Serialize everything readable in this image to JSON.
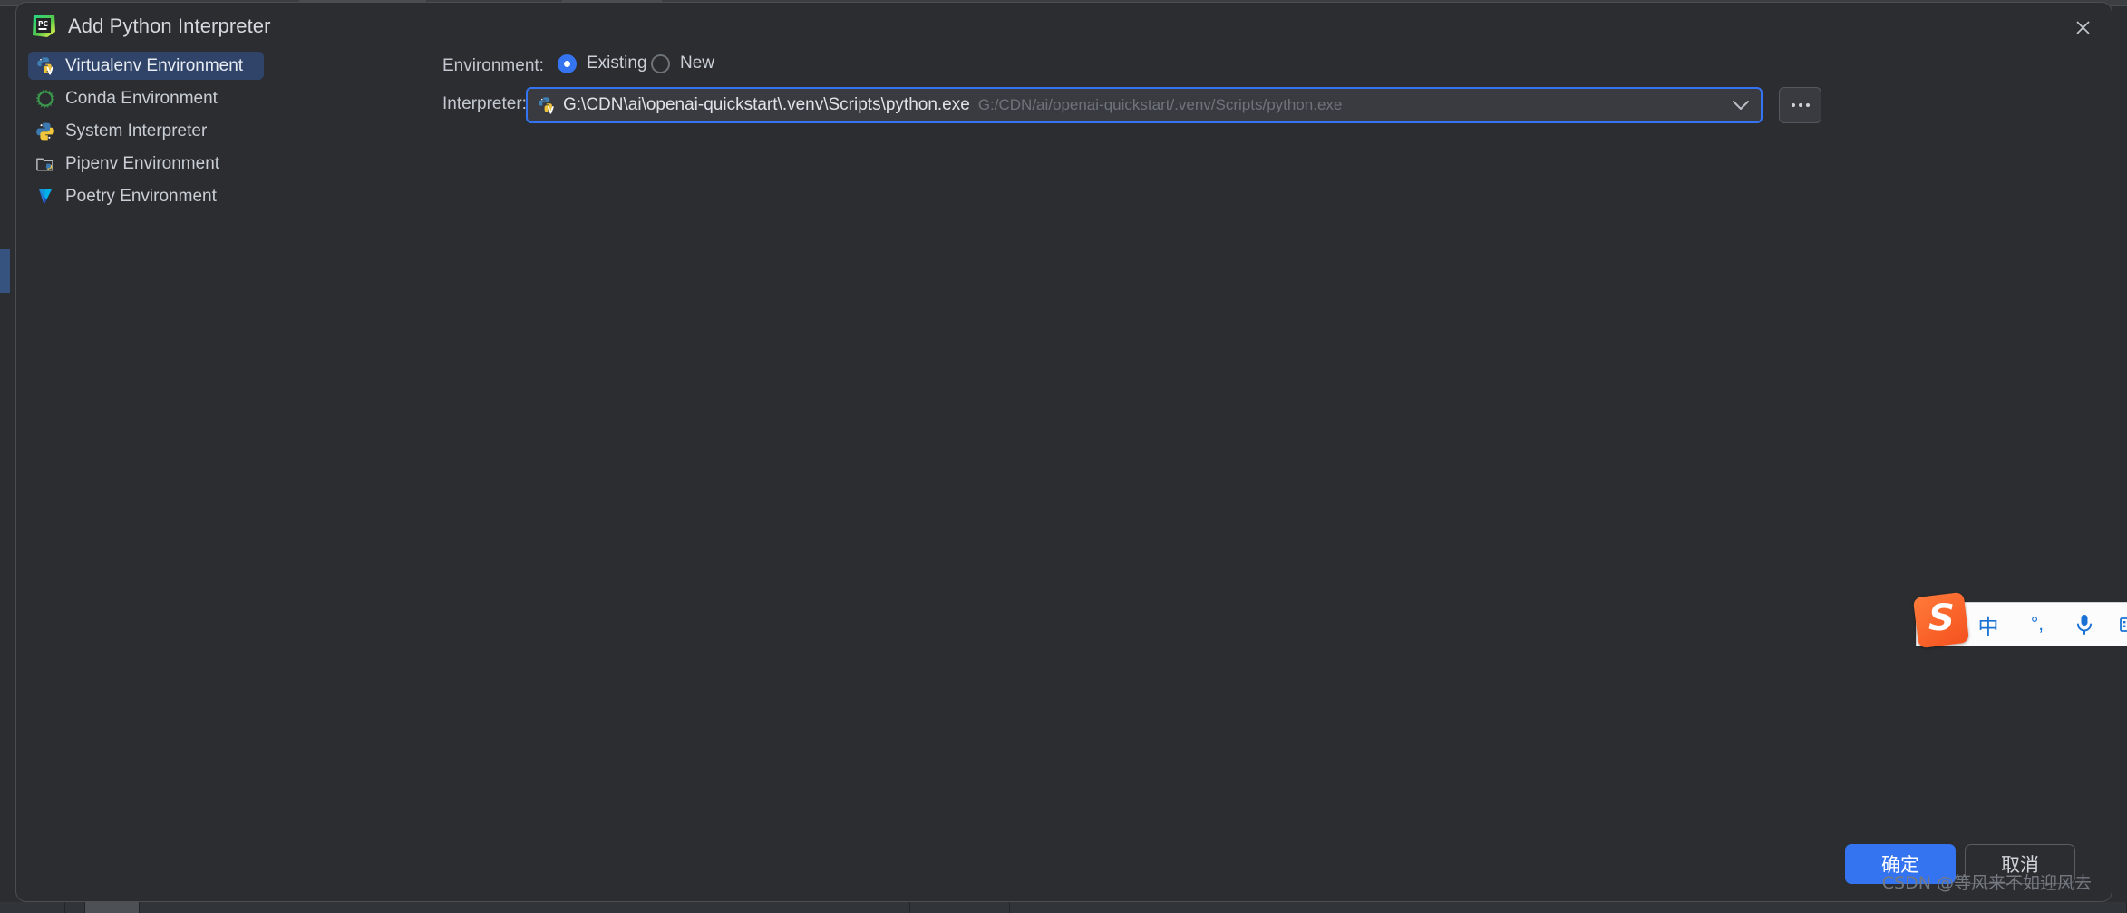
{
  "window": {
    "title": "Add Python Interpreter",
    "icon": "pycharm-icon",
    "close_icon": "close-icon"
  },
  "sidebar": {
    "items": [
      {
        "label": "Virtualenv Environment",
        "icon": "virtualenv-icon",
        "selected": true
      },
      {
        "label": "Conda Environment",
        "icon": "conda-icon",
        "selected": false
      },
      {
        "label": "System Interpreter",
        "icon": "python-icon",
        "selected": false
      },
      {
        "label": "Pipenv Environment",
        "icon": "pipenv-folder-icon",
        "selected": false
      },
      {
        "label": "Poetry Environment",
        "icon": "poetry-icon",
        "selected": false
      }
    ]
  },
  "form": {
    "environment_label": "Environment:",
    "interpreter_label": "Interpreter:",
    "radios": [
      {
        "label": "Existing",
        "selected": true
      },
      {
        "label": "New",
        "selected": false
      }
    ],
    "interpreter": {
      "value": "G:\\CDN\\ai\\openai-quickstart\\.venv\\Scripts\\python.exe",
      "hint": "G:/CDN/ai/openai-quickstart/.venv/Scripts/python.exe",
      "icon": "virtualenv-icon",
      "dropdown_icon": "chevron-down-icon",
      "browse_label": "...",
      "focus_color": "#3574f0"
    }
  },
  "footer": {
    "ok_label": "确定",
    "cancel_label": "取消",
    "ok_color": "#3574f0"
  },
  "ime": {
    "logo": "sogou-logo",
    "items": [
      {
        "name": "chinese-mode",
        "glyph": "中"
      },
      {
        "name": "punctuation-mode",
        "glyph": "°,"
      },
      {
        "name": "voice-input",
        "glyph": "mic-icon"
      },
      {
        "name": "soft-keyboard",
        "glyph": "keyboard-icon"
      }
    ]
  },
  "watermark": {
    "text": "CSDN @等风来不如迎风去"
  }
}
